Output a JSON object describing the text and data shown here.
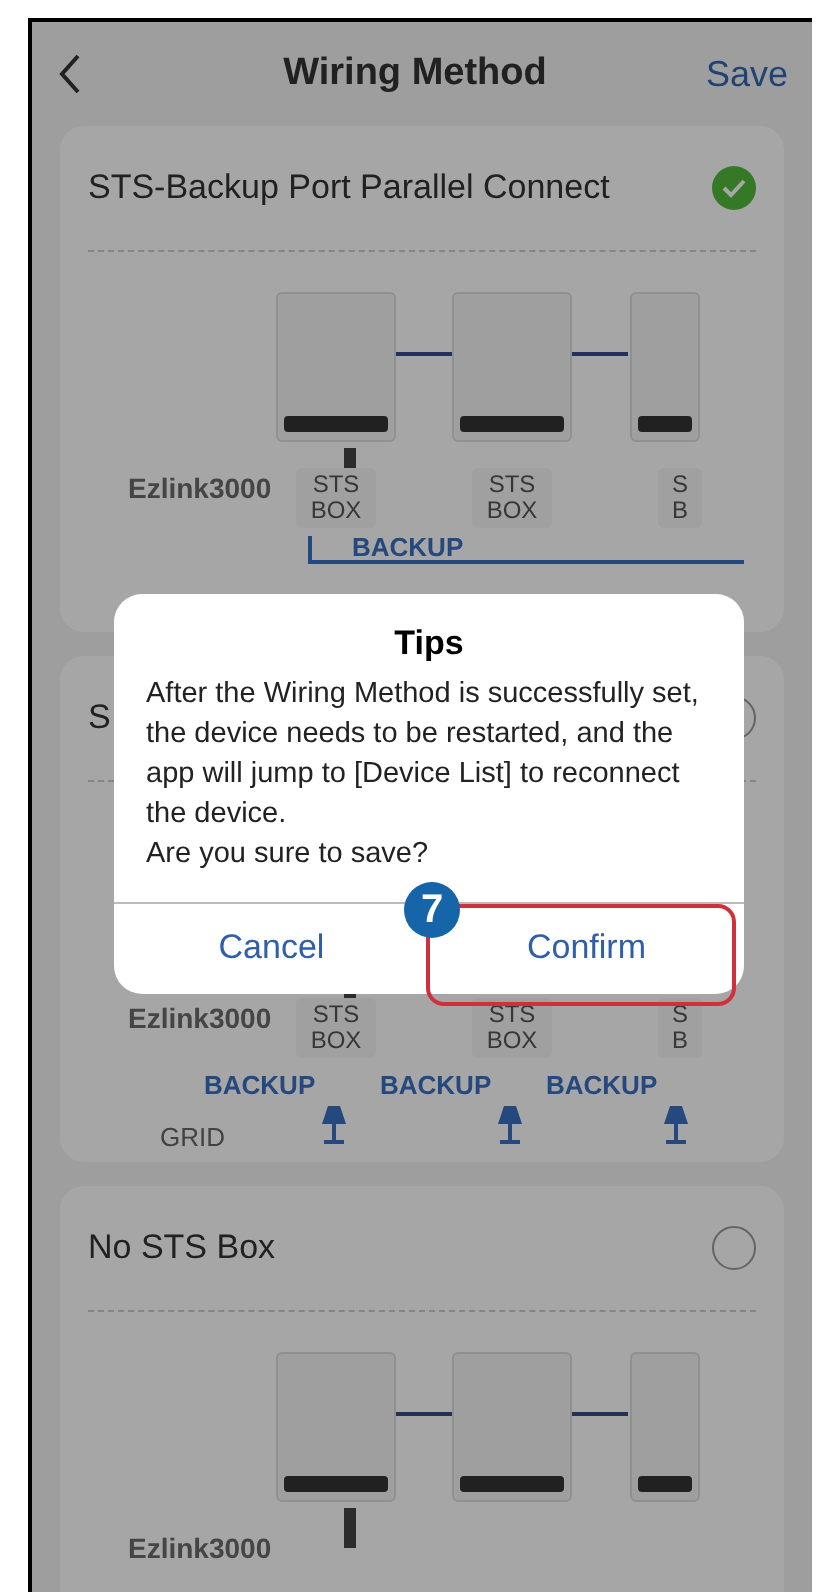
{
  "header": {
    "title": "Wiring Method",
    "action": "Save"
  },
  "options": [
    {
      "title": "STS-Backup Port Parallel Connect",
      "selected": true,
      "diagram": {
        "gateway_label": "Ezlink3000",
        "sts_boxes": [
          "STS BOX",
          "STS BOX",
          "S B"
        ],
        "backup_labels": [
          "BACKUP"
        ]
      }
    },
    {
      "title": "S",
      "selected": false,
      "diagram": {
        "gateway_label": "Ezlink3000",
        "sts_boxes": [
          "STS BOX",
          "STS BOX",
          "S B"
        ],
        "backup_labels": [
          "BACKUP",
          "BACKUP",
          "BACKUP"
        ],
        "grid_label": "GRID"
      }
    },
    {
      "title": "No STS Box",
      "selected": false,
      "diagram": {
        "gateway_label": "Ezlink3000"
      }
    }
  ],
  "dialog": {
    "title": "Tips",
    "message": "After the Wiring Method is successfully set, the device needs to be restarted, and the app will jump to [Device List] to reconnect the device.\nAre you sure to save?",
    "buttons": [
      "Cancel",
      "Confirm"
    ]
  },
  "annotation": {
    "step": "7"
  }
}
